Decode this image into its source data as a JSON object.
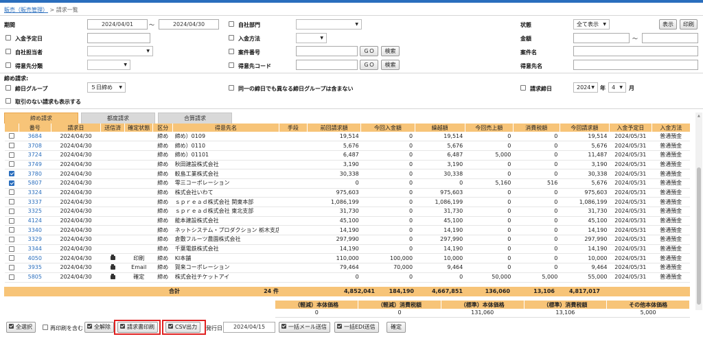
{
  "breadcrumb": {
    "parent": "販売（販売管理）",
    "sep": ">",
    "current": "請求一覧"
  },
  "filters": {
    "period_label": "期間",
    "period_from": "2024/04/01",
    "period_tilde": "～",
    "period_to": "2024/04/30",
    "dept_label": "自社部門",
    "status_label": "状態",
    "status_value": "全て表示",
    "display_button": "表示",
    "print_button": "印刷",
    "due_date_label": "入金予定日",
    "payment_method_label": "入金方法",
    "amount_label": "金額",
    "amount_tilde": "～",
    "staff_label": "自社担当者",
    "case_no_label": "案件番号",
    "go_button": "ＧＯ",
    "search_button": "検索",
    "case_name_label": "案件名",
    "customer_cat_label": "得意先分類",
    "customer_code_label": "得意先コード",
    "customer_name_label": "得意先名",
    "closing_header": "締め請求:",
    "closing_group_label": "締日グループ",
    "closing_group_value": "５日締め",
    "same_closing_label": "同一の締日でも異なる締日グループは含まない",
    "billing_closing_label": "請求締日",
    "year_value": "2024",
    "year_unit": "年",
    "month_value": "4",
    "month_unit": "月",
    "no_trade_label": "取引のない請求も表示する"
  },
  "tabs": [
    {
      "label": "締め請求",
      "active": true
    },
    {
      "label": "都度請求",
      "active": false
    },
    {
      "label": "合算請求",
      "active": false
    }
  ],
  "table": {
    "headers": [
      "",
      "番号",
      "請求日",
      "送信済",
      "確定状態",
      "区分",
      "得意先名",
      "手段",
      "前回請求額",
      "今回入金額",
      "繰越額",
      "今回売上額",
      "消費税額",
      "今回請求額",
      "入金予定日",
      "入金方法"
    ],
    "rows": [
      {
        "checked": false,
        "no": "3684",
        "date": "2024/04/30",
        "printed": false,
        "state": "",
        "kubun": "締め",
        "customer": "締め）0109",
        "method": "",
        "prev": "19,514",
        "paid": "0",
        "carry": "19,514",
        "sales": "0",
        "tax": "0",
        "bill": "19,514",
        "due": "2024/05/31",
        "pay": "普通預金"
      },
      {
        "checked": false,
        "no": "3708",
        "date": "2024/04/30",
        "printed": false,
        "state": "",
        "kubun": "締め",
        "customer": "締め）0110",
        "method": "",
        "prev": "5,676",
        "paid": "0",
        "carry": "5,676",
        "sales": "0",
        "tax": "0",
        "bill": "5,676",
        "due": "2024/05/31",
        "pay": "普通預金"
      },
      {
        "checked": false,
        "no": "3724",
        "date": "2024/04/30",
        "printed": false,
        "state": "",
        "kubun": "締め",
        "customer": "締め）01101",
        "method": "",
        "prev": "6,487",
        "paid": "0",
        "carry": "6,487",
        "sales": "5,000",
        "tax": "0",
        "bill": "11,487",
        "due": "2024/05/31",
        "pay": "普通預金"
      },
      {
        "checked": false,
        "no": "3749",
        "date": "2024/04/30",
        "printed": false,
        "state": "",
        "kubun": "締め",
        "customer": "秋田建設株式会社",
        "method": "",
        "prev": "3,190",
        "paid": "0",
        "carry": "3,190",
        "sales": "0",
        "tax": "0",
        "bill": "3,190",
        "due": "2024/05/31",
        "pay": "普通預金"
      },
      {
        "checked": true,
        "no": "3780",
        "date": "2024/04/30",
        "printed": false,
        "state": "",
        "kubun": "締め",
        "customer": "較島工業株式会社",
        "method": "",
        "prev": "30,338",
        "paid": "0",
        "carry": "30,338",
        "sales": "0",
        "tax": "0",
        "bill": "30,338",
        "due": "2024/05/31",
        "pay": "普通預金"
      },
      {
        "checked": true,
        "no": "5807",
        "date": "2024/04/30",
        "printed": false,
        "state": "",
        "kubun": "締め",
        "customer": "零三コーポレーション",
        "method": "",
        "prev": "0",
        "paid": "0",
        "carry": "0",
        "sales": "5,160",
        "tax": "516",
        "bill": "5,676",
        "due": "2024/05/31",
        "pay": "普通預金"
      },
      {
        "checked": false,
        "no": "3324",
        "date": "2024/04/30",
        "printed": false,
        "state": "",
        "kubun": "締め",
        "customer": "株式会社いわて",
        "method": "",
        "prev": "975,603",
        "paid": "0",
        "carry": "975,603",
        "sales": "0",
        "tax": "0",
        "bill": "975,603",
        "due": "2024/05/31",
        "pay": "普通預金"
      },
      {
        "checked": false,
        "no": "3337",
        "date": "2024/04/30",
        "printed": false,
        "state": "",
        "kubun": "締め",
        "customer": "ｓｐｒｅａｄ株式会社 関東本部",
        "method": "",
        "prev": "1,086,199",
        "paid": "0",
        "carry": "1,086,199",
        "sales": "0",
        "tax": "0",
        "bill": "1,086,199",
        "due": "2024/05/31",
        "pay": "普通預金"
      },
      {
        "checked": false,
        "no": "3325",
        "date": "2024/04/30",
        "printed": false,
        "state": "",
        "kubun": "締め",
        "customer": "ｓｐｒｅａｄ株式会社 東北支部",
        "method": "",
        "prev": "31,730",
        "paid": "0",
        "carry": "31,730",
        "sales": "0",
        "tax": "0",
        "bill": "31,730",
        "due": "2024/05/31",
        "pay": "普通預金"
      },
      {
        "checked": false,
        "no": "4124",
        "date": "2024/04/30",
        "printed": false,
        "state": "",
        "kubun": "締め",
        "customer": "能本建設株式会社",
        "method": "",
        "prev": "45,100",
        "paid": "0",
        "carry": "45,100",
        "sales": "0",
        "tax": "0",
        "bill": "45,100",
        "due": "2024/05/31",
        "pay": "普通預金"
      },
      {
        "checked": false,
        "no": "3340",
        "date": "2024/04/30",
        "printed": false,
        "state": "",
        "kubun": "締め",
        "customer": "ネットシステム・プロダクション 栃木支店",
        "method": "",
        "prev": "14,190",
        "paid": "0",
        "carry": "14,190",
        "sales": "0",
        "tax": "0",
        "bill": "14,190",
        "due": "2024/05/31",
        "pay": "普通預金"
      },
      {
        "checked": false,
        "no": "3329",
        "date": "2024/04/30",
        "printed": false,
        "state": "",
        "kubun": "締め",
        "customer": "倉敷フルーツ農園株式会社",
        "method": "",
        "prev": "297,990",
        "paid": "0",
        "carry": "297,990",
        "sales": "0",
        "tax": "0",
        "bill": "297,990",
        "due": "2024/05/31",
        "pay": "普通預金"
      },
      {
        "checked": false,
        "no": "3344",
        "date": "2024/04/30",
        "printed": false,
        "state": "",
        "kubun": "締め",
        "customer": "千葉電鉄株式会社",
        "method": "",
        "prev": "14,190",
        "paid": "0",
        "carry": "14,190",
        "sales": "0",
        "tax": "0",
        "bill": "14,190",
        "due": "2024/05/31",
        "pay": "普通預金"
      },
      {
        "checked": false,
        "no": "4050",
        "date": "2024/04/30",
        "printed": true,
        "state": "印刷",
        "kubun": "締め",
        "customer": "KI本舗",
        "method": "",
        "prev": "110,000",
        "paid": "100,000",
        "carry": "10,000",
        "sales": "0",
        "tax": "0",
        "bill": "10,000",
        "due": "2024/05/31",
        "pay": "普通預金"
      },
      {
        "checked": false,
        "no": "3935",
        "date": "2024/04/30",
        "printed": true,
        "state": "Email",
        "kubun": "締め",
        "customer": "賀来コーポレーション",
        "method": "",
        "prev": "79,464",
        "paid": "70,000",
        "carry": "9,464",
        "sales": "0",
        "tax": "0",
        "bill": "9,464",
        "due": "2024/05/31",
        "pay": "普通預金"
      },
      {
        "checked": false,
        "no": "5805",
        "date": "2024/04/30",
        "printed": true,
        "state": "確定",
        "kubun": "締め",
        "customer": "株式会社チケットアイ",
        "method": "",
        "prev": "0",
        "paid": "0",
        "carry": "0",
        "sales": "50,000",
        "tax": "5,000",
        "bill": "55,000",
        "due": "2024/05/31",
        "pay": "普通預金"
      }
    ]
  },
  "totals": {
    "label": "合計",
    "count": "24 件",
    "prev": "4,852,041",
    "paid": "184,190",
    "carry": "4,667,851",
    "sales": "136,060",
    "tax": "13,106",
    "bill": "4,817,017"
  },
  "tax_summary": {
    "headers": [
      "（軽減）本体価格",
      "（軽減）消費税額",
      "（標準）本体価格",
      "（標準）消費税額",
      "その他本体価格"
    ],
    "values": [
      "0",
      "0",
      "131,060",
      "13,106",
      "5,000"
    ]
  },
  "bottom": {
    "select_all": "全選択",
    "include_reprint": "再印刷を含む",
    "deselect_all": "全解除",
    "print_invoice": "請求書印刷",
    "csv_export": "CSV出力",
    "issue_date_label": "発行日",
    "issue_date": "2024/04/15",
    "bulk_mail": "一括メール送信",
    "bulk_edi": "一括EDI送信",
    "confirm": "確定"
  },
  "colors": {
    "accent": "#2a6ebd",
    "header_bg": "#f7c478",
    "highlight": "#e02020"
  }
}
